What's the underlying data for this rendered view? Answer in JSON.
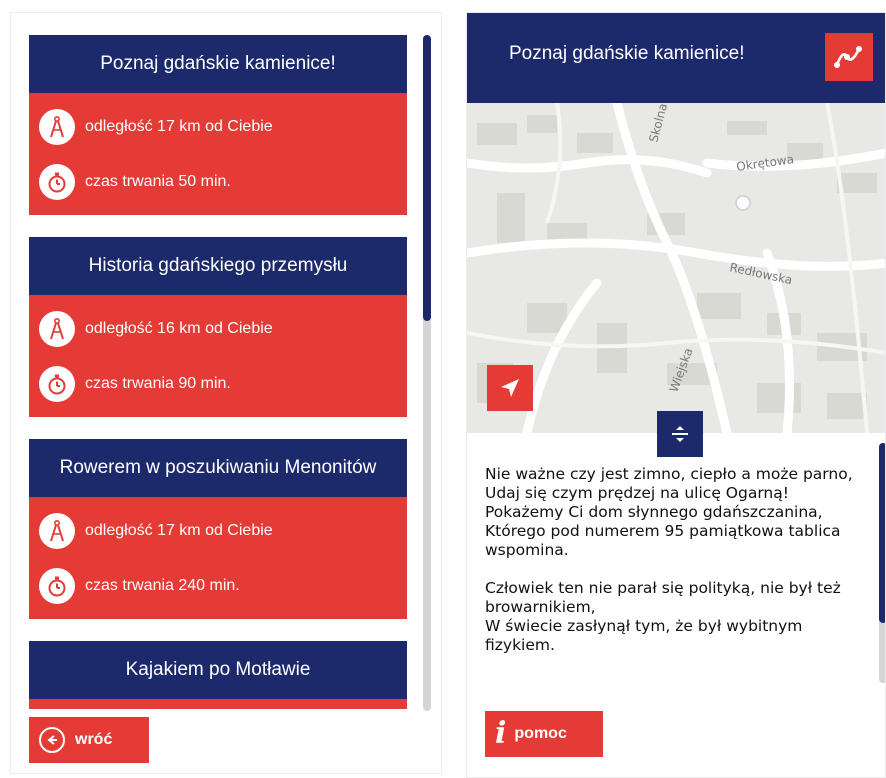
{
  "routes": [
    {
      "title": "Poznaj gdańskie kamienice!",
      "distance": "odległość 17 km od Ciebie",
      "duration": "czas trwania 50 min."
    },
    {
      "title": "Historia gdańskiego przemysłu",
      "distance": "odległość 16 km od Ciebie",
      "duration": "czas trwania 90 min."
    },
    {
      "title": "Rowerem w poszukiwaniu Menonitów",
      "distance": "odległość 17 km od Ciebie",
      "duration": "czas trwania 240 min."
    },
    {
      "title": "Kajakiem po Motławie"
    }
  ],
  "back_label": "wróć",
  "detail": {
    "title": "Poznaj gdańskie kamienice!",
    "map_labels": {
      "street1": "Okrętowa",
      "street2": "Redłowska",
      "street3": "Skolna",
      "street4": "Wiejska"
    },
    "description": [
      "Nie ważne czy jest zimno, ciepło a może parno,\nUdaj się czym prędzej na ulicę Ogarną!\nPokażemy Ci dom słynnego gdańszczanina,\nKtórego pod numerem 95 pamiątkowa tablica wspomina.",
      "Człowiek ten nie parał się polityką, nie był też browarnikiem,\nW świecie zasłynął tym, że był wybitnym fizykiem."
    ],
    "help_label": "pomoc"
  },
  "colors": {
    "navy": "#1c2a6b",
    "red": "#e53b36"
  }
}
